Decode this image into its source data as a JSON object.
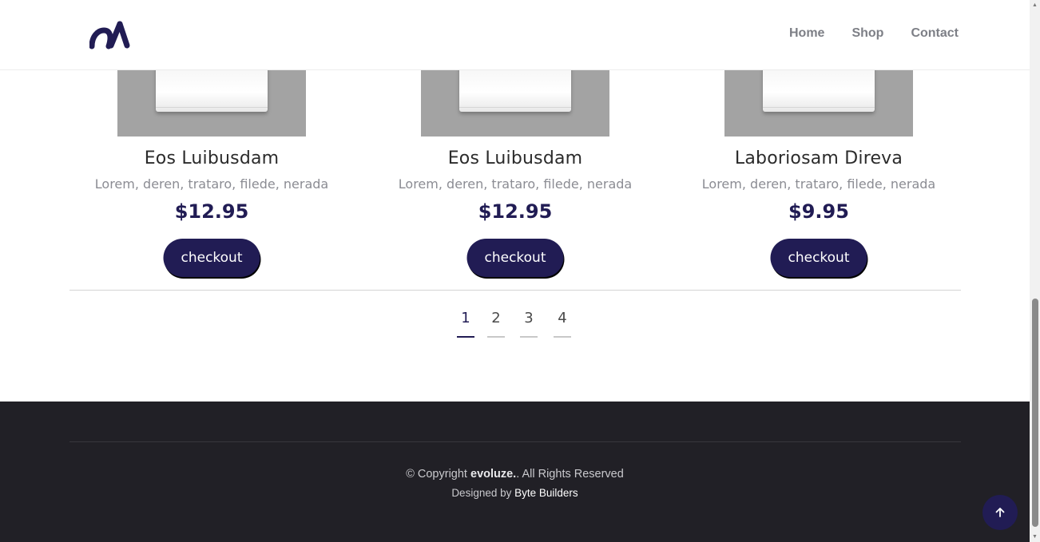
{
  "header": {
    "logo_name": "al-logo",
    "nav": [
      {
        "label": "Home"
      },
      {
        "label": "Shop"
      },
      {
        "label": "Contact"
      }
    ]
  },
  "products": [
    {
      "title": "Eos Luibusdam",
      "description": "Lorem, deren, trataro, filede, nerada",
      "price": "$12.95",
      "button": "checkout"
    },
    {
      "title": "Eos Luibusdam",
      "description": "Lorem, deren, trataro, filede, nerada",
      "price": "$12.95",
      "button": "checkout"
    },
    {
      "title": "Laboriosam Direva",
      "description": "Lorem, deren, trataro, filede, nerada",
      "price": "$9.95",
      "button": "checkout"
    }
  ],
  "pagination": {
    "pages": [
      "1",
      "2",
      "3",
      "4"
    ],
    "active": "1"
  },
  "footer": {
    "copyright_prefix": "© Copyright",
    "brand": "evoluze.",
    "copyright_suffix": ". All Rights Reserved",
    "designed_prefix": "Designed by",
    "designer": "Byte Builders"
  },
  "back_to_top_icon": "arrow-up-icon",
  "colors": {
    "brand": "#211c54",
    "footer_bg": "#212026",
    "nav_text": "#7d7f86"
  }
}
